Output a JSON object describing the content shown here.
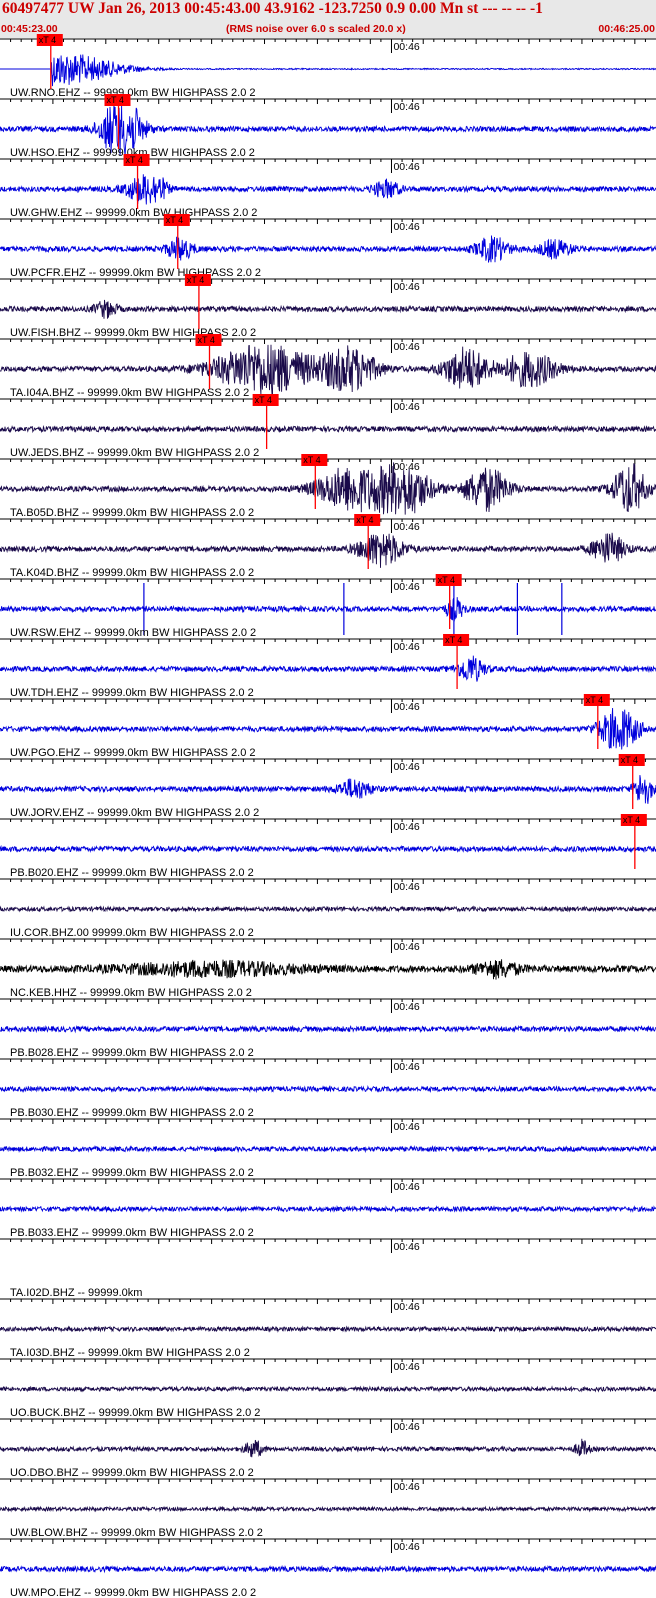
{
  "header": {
    "title": "60497477 UW Jan 26, 2013 00:45:43.00   43.9162 -123.7250  0.9 0.00 Mn st --- -- --  -1",
    "start_time": "00:45:23.00",
    "rms_note": "(RMS noise over 6.0 s scaled 20.0 x)",
    "end_time": "00:46:25.00"
  },
  "chart_data": {
    "type": "line",
    "x_range_seconds": [
      0,
      62
    ],
    "x_start_label": "00:45:23.00",
    "x_end_label": "00:46:25.00",
    "minute_mark_label": "00:46",
    "minute_mark_seconds": 37,
    "pick_label": "xT 4",
    "colors": {
      "blue": "#0000dd",
      "dark": "#1a0a4a",
      "black": "#000000",
      "pick": "#ff0000",
      "grid": "#000000"
    },
    "traces": [
      {
        "label": "UW.RNO.EHZ -- 99999.0km BW  HIGHPASS  2.0  2",
        "pick_s": 4.8,
        "color": "blue",
        "amp": 0.1,
        "mode": "rno",
        "events": [
          [
            5.5,
            5.5,
            4.0
          ]
        ]
      },
      {
        "label": "UW.HSO.EHZ -- 99999.0km BW  HIGHPASS  2.0  2",
        "pick_s": 11.2,
        "color": "blue",
        "amp": 1.0,
        "events": [
          [
            11.5,
            1.8,
            8.0
          ]
        ]
      },
      {
        "label": "UW.GHW.EHZ -- 99999.0km BW  HIGHPASS  2.0  2",
        "pick_s": 13.0,
        "color": "blue",
        "amp": 1.0,
        "events": [
          [
            13.5,
            1.5,
            3.2
          ],
          [
            15.0,
            0.8,
            2.0
          ],
          [
            36.5,
            1.2,
            2.0
          ]
        ]
      },
      {
        "label": "UW.PCFR.EHZ -- 99999.0km BW  HIGHPASS  2.0  2",
        "pick_s": 16.8,
        "color": "blue",
        "amp": 1.0,
        "events": [
          [
            17.0,
            1.2,
            2.5
          ],
          [
            46.5,
            1.5,
            2.8
          ],
          [
            52.5,
            1.5,
            2.0
          ]
        ]
      },
      {
        "label": "UW.FISH.BHZ -- 99999.0km BW  HIGHPASS  2.0  2",
        "pick_s": 18.8,
        "color": "dark",
        "amp": 1.0,
        "events": [
          [
            10.0,
            1.0,
            1.8
          ]
        ]
      },
      {
        "label": "TA.I04A.BHZ -- 99999.0km BW  HIGHPASS  2.0  2",
        "pick_s": 19.8,
        "color": "dark",
        "amp": 1.0,
        "events": [
          [
            25.0,
            4.5,
            6.0
          ],
          [
            33.0,
            2.5,
            5.0
          ],
          [
            44.0,
            2.0,
            5.0
          ],
          [
            50.0,
            2.5,
            4.0
          ]
        ]
      },
      {
        "label": "UW.JEDS.BHZ -- 99999.0km BW  HIGHPASS  2.0  2",
        "pick_s": 25.2,
        "color": "dark",
        "amp": 1.0,
        "events": []
      },
      {
        "label": "TA.B05D.BHZ -- 99999.0km BW  HIGHPASS  2.0  2",
        "pick_s": 29.8,
        "color": "dark",
        "amp": 1.0,
        "events": [
          [
            33.0,
            3.0,
            5.0
          ],
          [
            38.0,
            2.5,
            6.5
          ],
          [
            46.0,
            2.0,
            5.0
          ],
          [
            59.5,
            1.5,
            6.0
          ]
        ]
      },
      {
        "label": "TA.K04D.BHZ -- 99999.0km BW  HIGHPASS  2.0  2",
        "pick_s": 34.8,
        "color": "dark",
        "amp": 1.0,
        "events": [
          [
            36.0,
            2.0,
            4.0
          ],
          [
            57.5,
            1.5,
            3.5
          ]
        ]
      },
      {
        "label": "UW.RSW.EHZ -- 99999.0km BW  HIGHPASS  2.0  2",
        "pick_s": 42.5,
        "color": "blue",
        "amp": 1.0,
        "spikes": [
          13.6,
          32.5,
          42.9,
          48.9,
          53.1
        ],
        "events": [
          [
            43.0,
            0.8,
            2.5
          ]
        ]
      },
      {
        "label": "UW.TDH.EHZ -- 99999.0km BW  HIGHPASS  2.0  2",
        "pick_s": 43.2,
        "color": "blue",
        "amp": 1.0,
        "events": [
          [
            44.5,
            1.2,
            3.0
          ]
        ]
      },
      {
        "label": "UW.PGO.EHZ -- 99999.0km BW  HIGHPASS  2.0  2",
        "pick_s": 56.5,
        "color": "blue",
        "amp": 1.0,
        "events": [
          [
            58.5,
            1.8,
            5.0
          ]
        ]
      },
      {
        "label": "UW.JORV.EHZ -- 99999.0km BW  HIGHPASS  2.0  2",
        "pick_s": 59.8,
        "color": "blue",
        "amp": 1.0,
        "events": [
          [
            33.5,
            1.5,
            2.2
          ],
          [
            60.8,
            0.8,
            4.0
          ]
        ]
      },
      {
        "label": "PB.B020.EHZ -- 99999.0km BW  HIGHPASS  2.0  2",
        "pick_s": 60.0,
        "color": "blue",
        "amp": 1.0,
        "events": []
      },
      {
        "label": "IU.COR.BHZ.00 99999.0km BW  HIGHPASS  2.0  2",
        "color": "dark",
        "amp": 0.8,
        "events": []
      },
      {
        "label": "NC.KEB.HHZ -- 99999.0km BW  HIGHPASS  2.0  2",
        "color": "black",
        "amp": 1.3,
        "events": [
          [
            20.0,
            8.0,
            1.5
          ],
          [
            47.0,
            2.0,
            1.8
          ]
        ]
      },
      {
        "label": "PB.B028.EHZ -- 99999.0km BW  HIGHPASS  2.0  2",
        "color": "blue",
        "amp": 1.0,
        "events": []
      },
      {
        "label": "PB.B030.EHZ -- 99999.0km BW  HIGHPASS  2.0  2",
        "color": "blue",
        "amp": 0.9,
        "events": []
      },
      {
        "label": "PB.B032.EHZ -- 99999.0km BW  HIGHPASS  2.0  2",
        "color": "blue",
        "amp": 0.9,
        "events": []
      },
      {
        "label": "PB.B033.EHZ -- 99999.0km BW  HIGHPASS  2.0  2",
        "color": "blue",
        "amp": 0.9,
        "events": []
      },
      {
        "label": "TA.I02D.BHZ -- 99999.0km",
        "color": "dark",
        "amp": 0,
        "events": []
      },
      {
        "label": "TA.I03D.BHZ -- 99999.0km BW  HIGHPASS  2.0  2",
        "color": "dark",
        "amp": 0.8,
        "events": []
      },
      {
        "label": "UO.BUCK.BHZ -- 99999.0km BW  HIGHPASS  2.0  2",
        "color": "dark",
        "amp": 0.8,
        "events": []
      },
      {
        "label": "UO.DBO.BHZ -- 99999.0km BW  HIGHPASS  2.0  2",
        "color": "dark",
        "amp": 0.8,
        "events": [
          [
            24.0,
            0.8,
            2.0
          ],
          [
            55.0,
            0.6,
            2.0
          ]
        ]
      },
      {
        "label": "UW.BLOW.BHZ -- 99999.0km BW  HIGHPASS  2.0  2",
        "color": "dark",
        "amp": 0.7,
        "events": []
      },
      {
        "label": "UW.MPO.EHZ -- 99999.0km BW  HIGHPASS  2.0  2",
        "color": "blue",
        "amp": 1.0,
        "events": []
      }
    ]
  }
}
